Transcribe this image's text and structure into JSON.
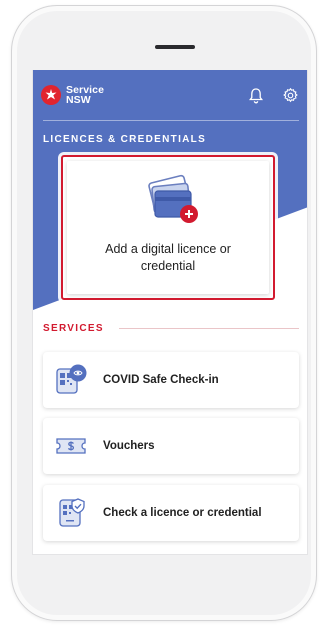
{
  "brand": {
    "line1": "Service",
    "line2": "NSW"
  },
  "header": {
    "notifications_icon": "bell-icon",
    "settings_icon": "gear-icon"
  },
  "licences": {
    "heading": "LICENCES & CREDENTIALS",
    "add_card_label": "Add a digital licence or credential"
  },
  "services": {
    "heading": "SERVICES",
    "items": [
      {
        "label": "COVID Safe Check-in",
        "icon": "covid-safe-qr-icon"
      },
      {
        "label": "Vouchers",
        "icon": "voucher-icon"
      },
      {
        "label": "Check a licence or credential",
        "icon": "check-licence-icon"
      }
    ]
  },
  "colors": {
    "brand_blue": "#5470bf",
    "accent_red": "#d21a2f"
  }
}
